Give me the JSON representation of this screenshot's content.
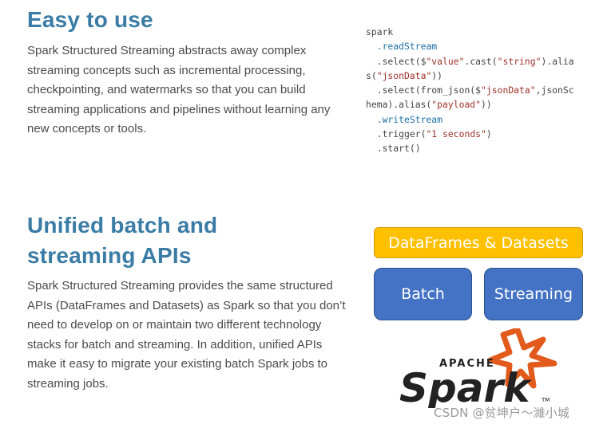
{
  "section1": {
    "heading": "Easy to use",
    "body": "Spark Structured Streaming abstracts away complex streaming concepts such as incremental processing, checkpointing, and watermarks so that you can build streaming applications and pipelines without learning any new concepts or tools."
  },
  "code": {
    "l1": "spark",
    "l2_method": ".readStream",
    "l3_a": ".select($",
    "l3_s1": "\"value\"",
    "l3_b": ".cast(",
    "l3_s2": "\"string\"",
    "l3_c": ").alia",
    "l4_a": "s(",
    "l4_s": "\"jsonData\"",
    "l4_b": "))",
    "l5_a": ".select(from_json($",
    "l5_s": "\"jsonData\"",
    "l5_b": ",jsonSc",
    "l6_a": "hema).alias(",
    "l6_s": "\"payload\"",
    "l6_b": "))",
    "l7_method": ".writeStream",
    "l8_a": ".trigger(",
    "l8_s": "\"1 seconds\"",
    "l8_b": ")",
    "l9_method": ".start()"
  },
  "section2": {
    "heading_line1": "Unified batch and",
    "heading_line2": "streaming APIs",
    "body": "Spark Structured Streaming provides the same structured APIs (DataFrames and Datasets) as Spark so that you don’t need to develop on or maintain two different technology stacks for batch and streaming. In addition, unified APIs make it easy to migrate your existing batch Spark jobs to streaming jobs."
  },
  "diagram": {
    "top_box": "DataFrames & Datasets",
    "left_box": "Batch",
    "right_box": "Streaming",
    "colors": {
      "top": "#ffc000",
      "bottom": "#4472c4",
      "spark_star": "#e25a1c"
    }
  },
  "logo": {
    "apache": "APACHE",
    "spark": "Spark",
    "tm": "TM",
    "icon": "spark-star-icon"
  },
  "watermark": "CSDN @贫坤户～濰小城"
}
